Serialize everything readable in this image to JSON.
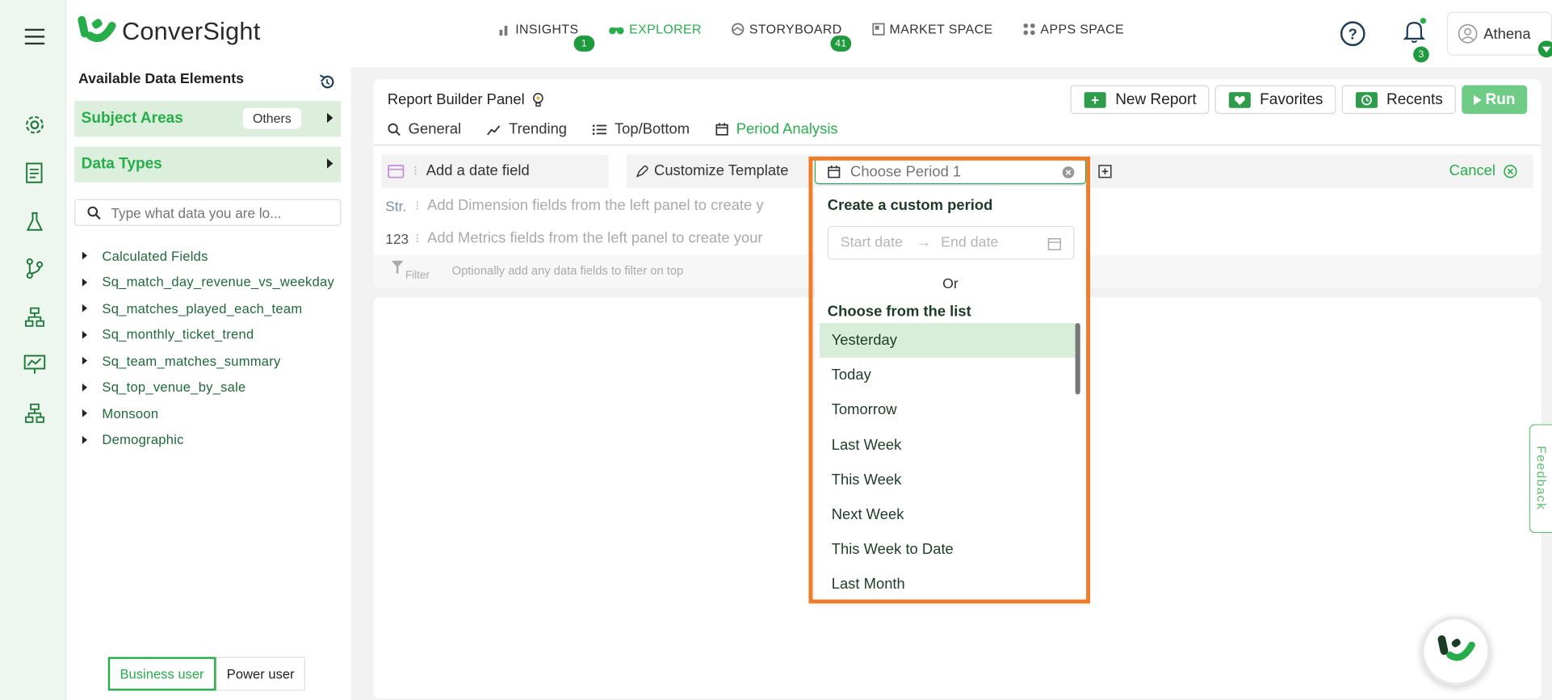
{
  "brand": {
    "name": "ConverSight"
  },
  "topnav": [
    {
      "label": "INSIGHTS",
      "badge": "1"
    },
    {
      "label": "EXPLORER",
      "badge": ""
    },
    {
      "label": "STORYBOARD",
      "badge": "41"
    },
    {
      "label": "MARKET SPACE",
      "badge": ""
    },
    {
      "label": "APPS SPACE",
      "badge": ""
    }
  ],
  "header": {
    "notifications": "3",
    "user": "Athena"
  },
  "data_panel": {
    "title": "Available Data Elements",
    "subject_areas": "Subject Areas",
    "subject_pill": "Others",
    "data_types": "Data Types",
    "search_placeholder": "Type what data you are lo...",
    "items": [
      "Calculated Fields",
      "Sq_match_day_revenue_vs_weekday",
      "Sq_matches_played_each_team",
      "Sq_monthly_ticket_trend",
      "Sq_team_matches_summary",
      "Sq_top_venue_by_sale",
      "Monsoon",
      "Demographic"
    ],
    "modes": [
      "Business user",
      "Power user"
    ]
  },
  "builder": {
    "title": "Report Builder Panel",
    "buttons": {
      "new_report": "New Report",
      "favorites": "Favorites",
      "recents": "Recents",
      "run": "Run"
    },
    "tabs": [
      "General",
      "Trending",
      "Top/Bottom",
      "Period Analysis"
    ],
    "date_field": "Add a date field",
    "customize": "Customize Template",
    "cancel": "Cancel",
    "dimension_lead": "Str.",
    "dimension_hint": "Add Dimension fields from the left panel to create y",
    "metrics_lead": "123",
    "metrics_hint": "Add Metrics fields from the left panel to create your",
    "filter_label": "Filter",
    "filter_hint": "Optionally add any data fields to filter on top"
  },
  "period": {
    "placeholder": "Choose Period 1",
    "custom_heading": "Create a custom period",
    "start_placeholder": "Start date",
    "end_placeholder": "End date",
    "or": "Or",
    "list_heading": "Choose from the list",
    "options": [
      "Yesterday",
      "Today",
      "Tomorrow",
      "Last Week",
      "This Week",
      "Next Week",
      "This Week to Date",
      "Last Month"
    ],
    "selected": "Yesterday"
  },
  "feedback": "Feedback",
  "colors": {
    "accent": "#27ae4b",
    "highlight": "#f07c2b",
    "selected_bg": "#d8eed8"
  }
}
